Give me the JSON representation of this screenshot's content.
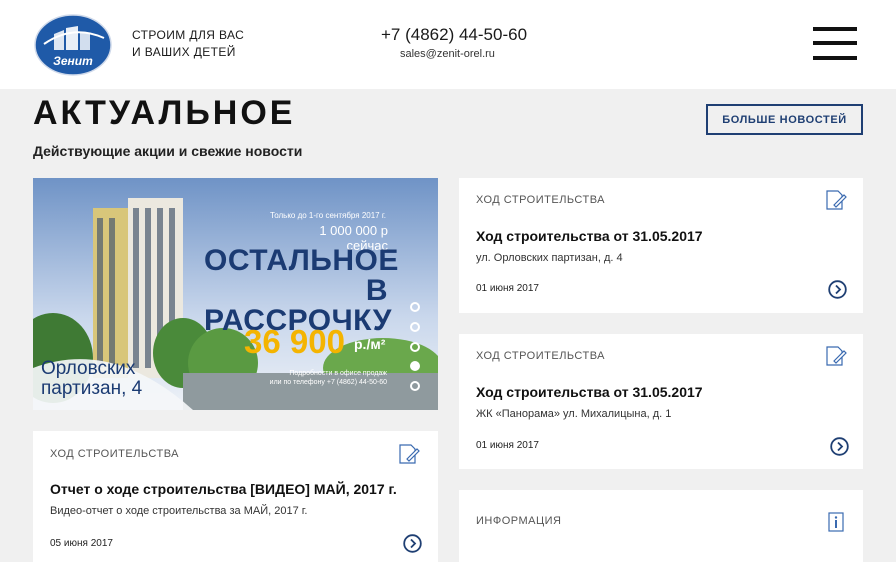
{
  "header": {
    "logo_text": "Зенит",
    "tagline_line1": "СТРОИМ ДЛЯ ВАС",
    "tagline_line2": "И ВАШИХ ДЕТЕЙ",
    "phone": "+7 (4862) 44-50-60",
    "email": "sales@zenit-orel.ru",
    "menu_icon": "hamburger-menu-icon"
  },
  "section": {
    "title": "АКТУАЛЬНОЕ",
    "subtitle": "Действующие акции и свежие новости",
    "more_button": "БОЛЬШЕ НОВОСТЕЙ"
  },
  "banner": {
    "small_text": "Только до 1-го сентября 2017 г.",
    "sum_text": "1 000 000 р сейчас",
    "headline_line1": "ОСТАЛЬНОЕ",
    "headline_line2": "В РАССРОЧКУ",
    "price": "36 900",
    "price_unit": "р./м²",
    "note_line1": "Подробности в офисе продаж",
    "note_line2": "или по телефону +7 (4862) 44-50-60",
    "address_line1": "Орловских",
    "address_line2": "партизан, 4",
    "slides": 5,
    "active_slide": 4
  },
  "cards": [
    {
      "category": "ХОД СТРОИТЕЛЬСТВА",
      "title": "Ход строительства от 31.05.2017",
      "desc": "ул. Орловских партизан, д. 4",
      "date": "01 июня 2017",
      "icon": "document-pen-icon"
    },
    {
      "category": "ХОД СТРОИТЕЛЬСТВА",
      "title": "Ход строительства от 31.05.2017",
      "desc": "ЖК «Панорама» ул. Михалицына, д. 1",
      "date": "01 июня 2017",
      "icon": "document-pen-icon"
    },
    {
      "category": "ИНФОРМАЦИЯ",
      "title": "",
      "desc": "",
      "date": "",
      "icon": "info-icon"
    },
    {
      "category": "ХОД СТРОИТЕЛЬСТВА",
      "title": "Отчет о ходе строительства [ВИДЕО] МАЙ, 2017 г.",
      "desc": "Видео-отчет о ходе строительства за МАЙ, 2017 г.",
      "date": "05 июня 2017",
      "icon": "document-pen-icon"
    }
  ],
  "colors": {
    "brand_blue": "#1f3f73",
    "accent_yellow": "#f4b400",
    "page_bg": "#f0f0f0"
  }
}
